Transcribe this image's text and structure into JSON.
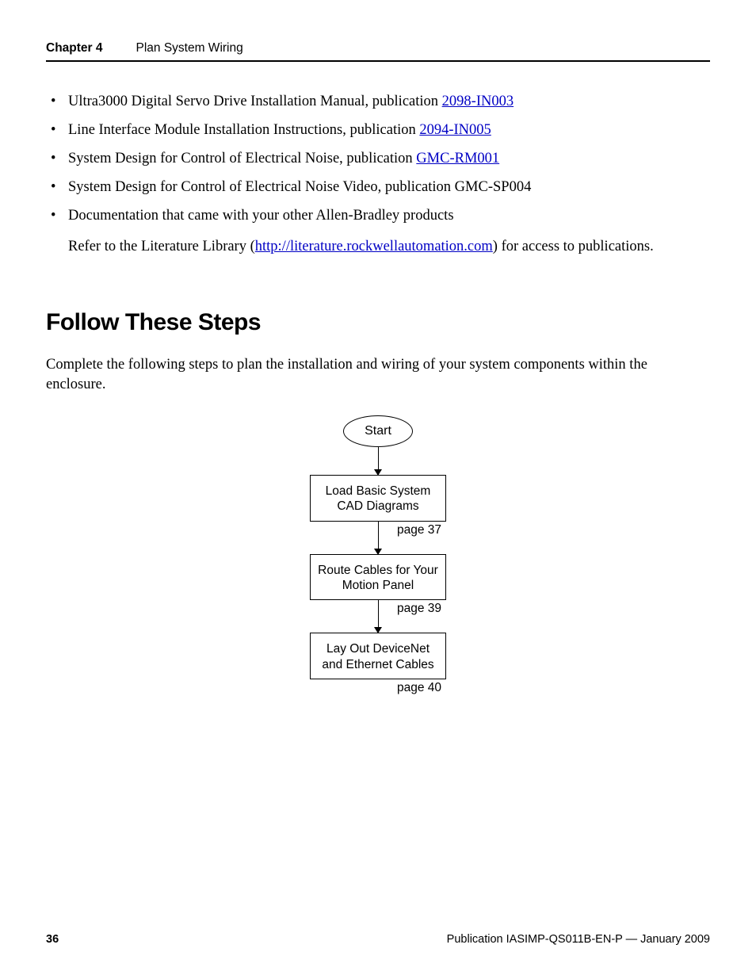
{
  "header": {
    "chapter_label": "Chapter 4",
    "chapter_title": "Plan System Wiring"
  },
  "bullets": {
    "b1_pre": "Ultra3000 Digital Servo Drive Installation Manual, publication ",
    "b1_link": "2098-IN003",
    "b2_pre": "Line Interface Module Installation Instructions, publication ",
    "b2_link": "2094-IN005",
    "b3_pre": "System Design for Control of Electrical Noise, publication ",
    "b3_link": "GMC-RM001",
    "b4": "System Design for Control of Electrical Noise Video, publication GMC-SP004",
    "b5": "Documentation that came with your other Allen-Bradley products"
  },
  "refer": {
    "pre": "Refer to the Literature Library (",
    "link": "http://literature.rockwellautomation.com",
    "post": ") for access to publications."
  },
  "section_head": "Follow These Steps",
  "intro": "Complete the following steps to plan the installation and wiring of your system components within the enclosure.",
  "flow": {
    "start": "Start",
    "step1": "Load Basic System CAD Diagrams",
    "page1": "page 37",
    "step2": "Route Cables for Your Motion Panel",
    "page2": "page 39",
    "step3": "Lay Out DeviceNet and Ethernet Cables",
    "page3": "page 40"
  },
  "footer": {
    "page_num": "36",
    "pub": "Publication IASIMP-QS011B-EN-P — January 2009"
  }
}
